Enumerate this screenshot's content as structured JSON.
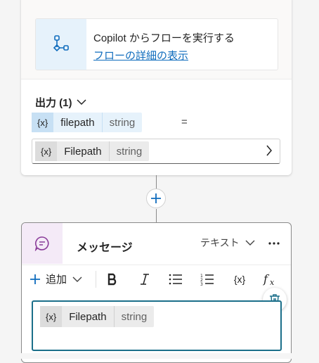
{
  "flow_card": {
    "title": "Copilot からフローを実行する",
    "link": "フローの詳細の表示"
  },
  "outputs": {
    "header": "出力 (1)",
    "variable": {
      "icon_text": "{x}",
      "name": "filepath",
      "type": "string"
    },
    "equals": "=",
    "selected": {
      "icon_text": "{x}",
      "name": "Filepath",
      "type": "string"
    }
  },
  "message_card": {
    "title": "メッセージ",
    "type_label": "テキスト",
    "toolbar": {
      "add_label": "追加",
      "icons": [
        "bold-icon",
        "italic-icon",
        "bulleted-list-icon",
        "numbered-list-icon",
        "variable-icon",
        "formula-icon"
      ],
      "variable_text": "{x}"
    },
    "editor_chip": {
      "icon_text": "{x}",
      "name": "Filepath",
      "type": "string"
    }
  },
  "colors": {
    "link": "#0f6cbd",
    "editor_border": "#1b6f8a",
    "flow_icon_bg": "#e6f2fb",
    "message_icon_bg": "#f4eaf7"
  }
}
